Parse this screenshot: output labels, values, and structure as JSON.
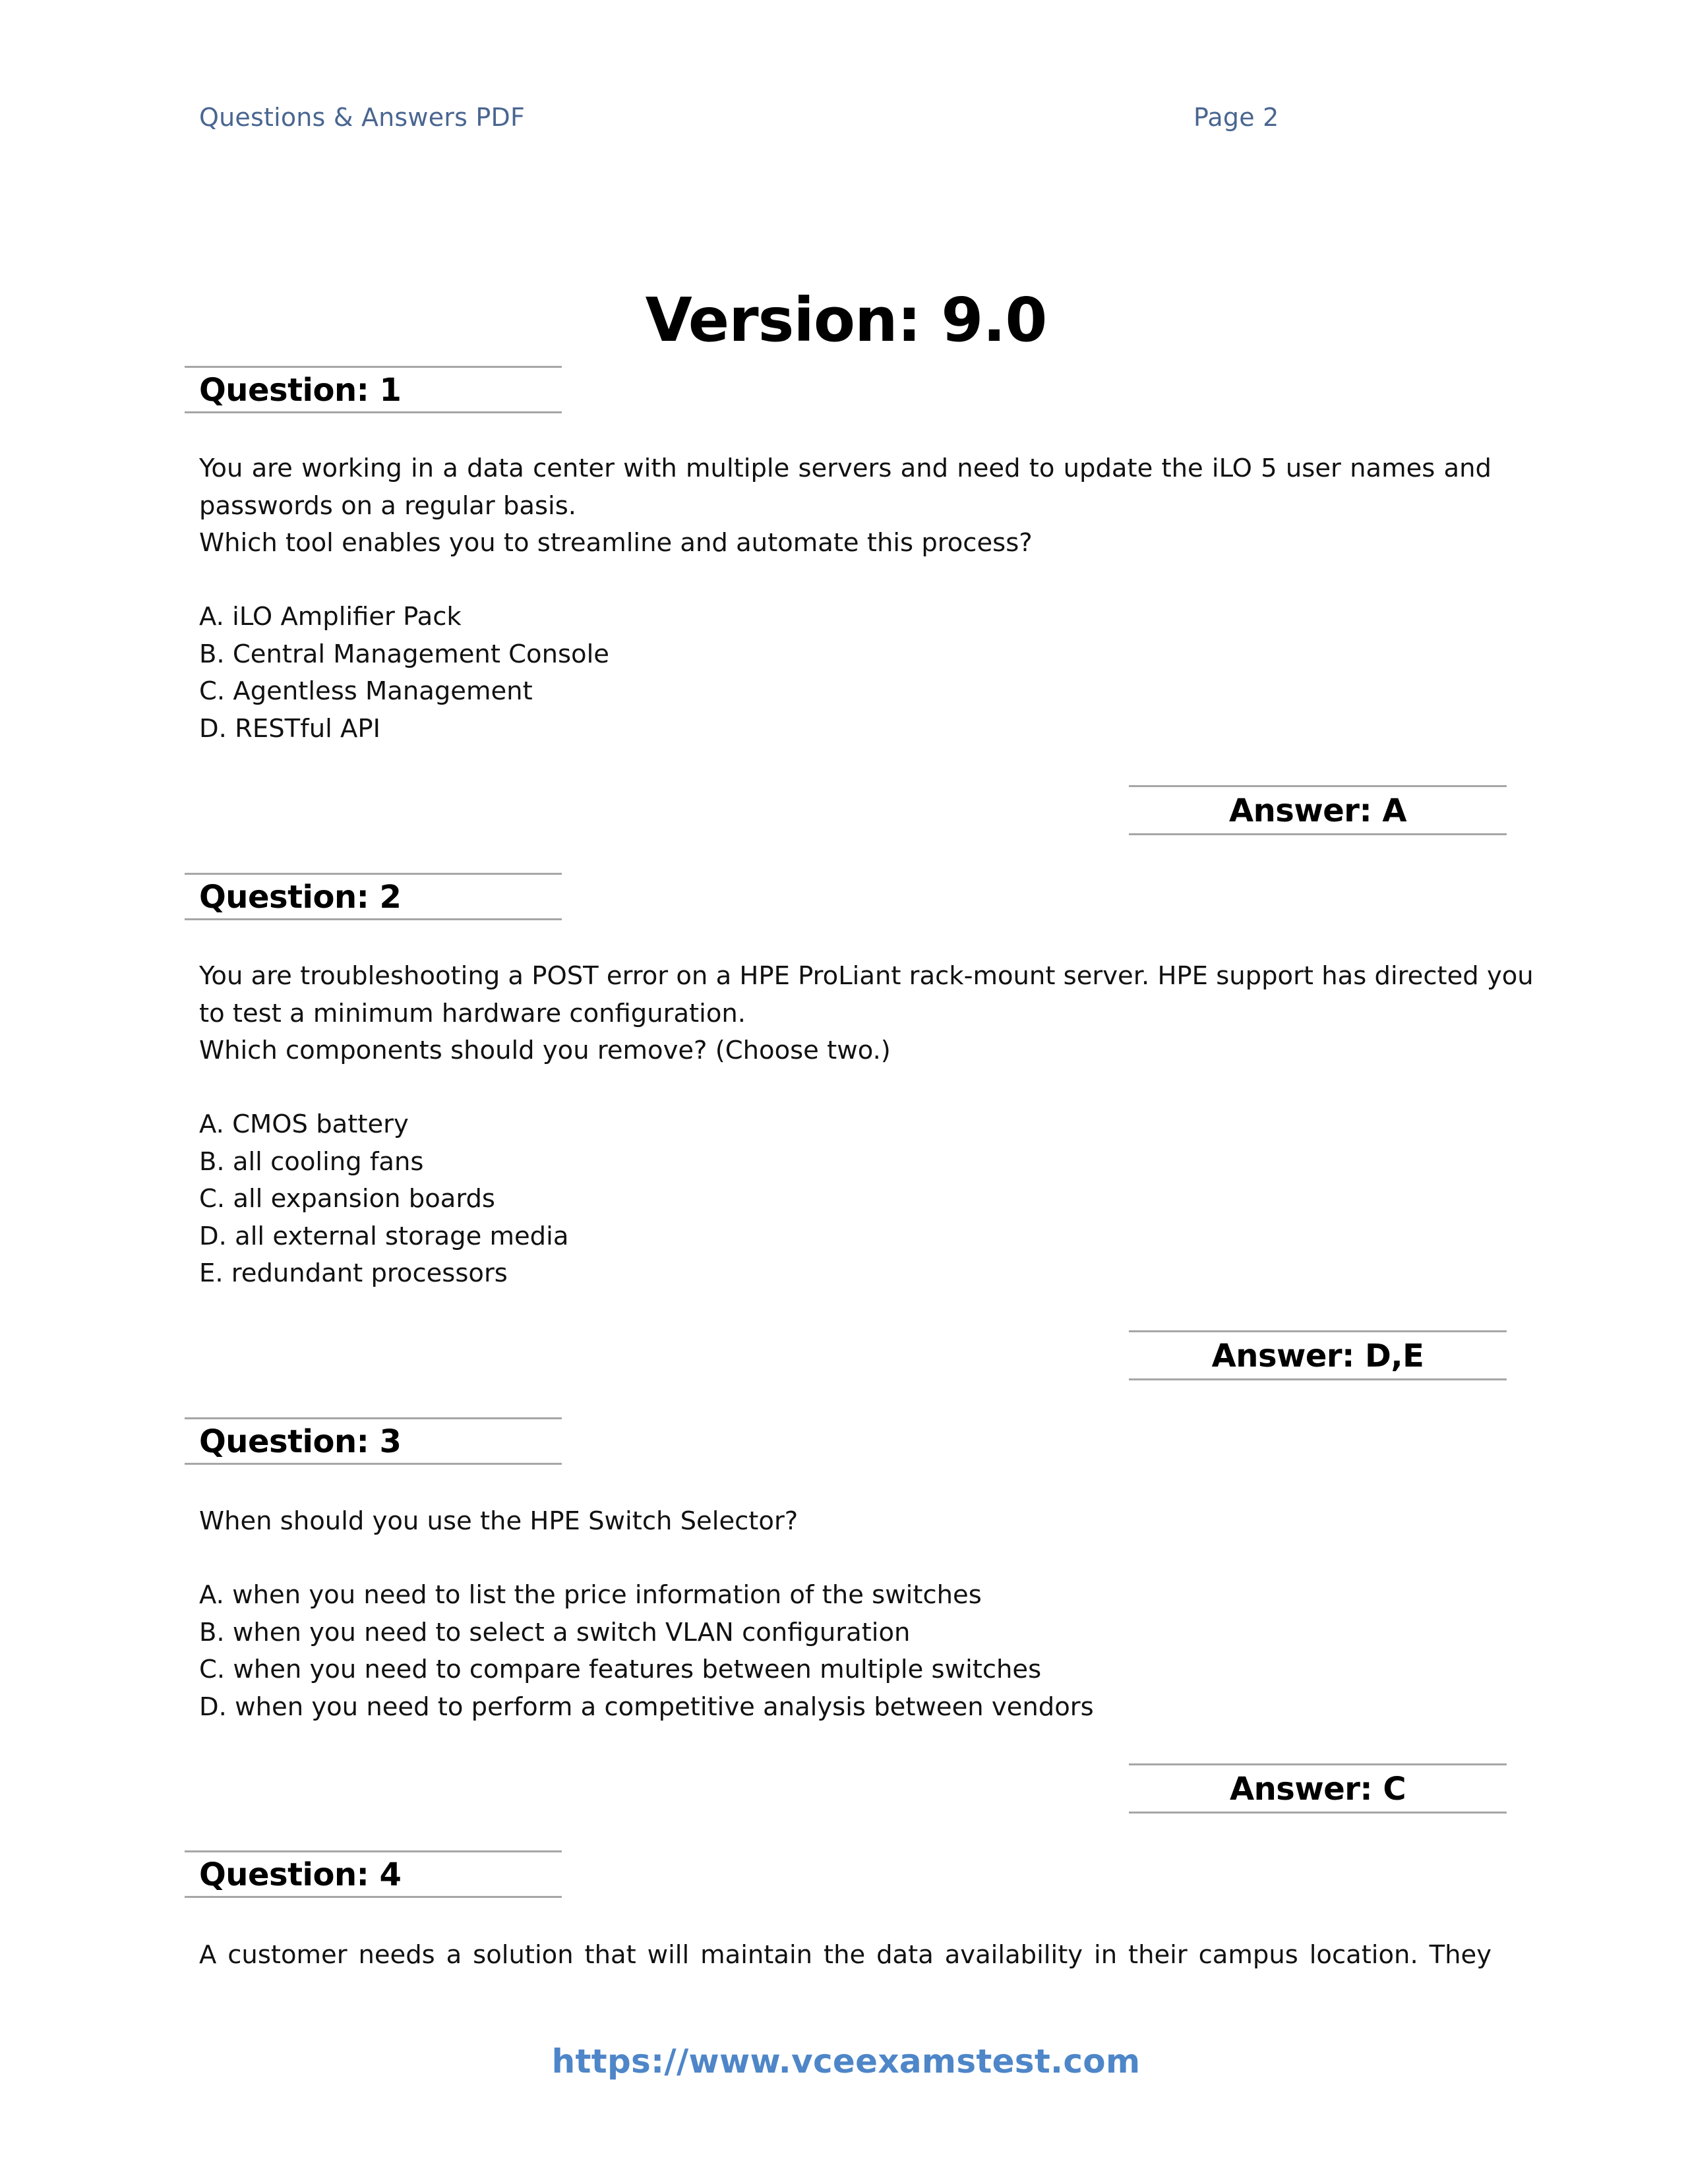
{
  "header": {
    "left_title": "Questions & Answers PDF",
    "page_label": "Page 2"
  },
  "version_title": "Version: 9.0",
  "questions": [
    {
      "label": "Question: 1",
      "stem_lines": [
        "You are working in a data center with multiple servers and need to update the iLO 5 user names and",
        "passwords on a regular basis.",
        "Which tool enables you to streamline and automate this process?"
      ],
      "options": [
        "A. iLO Amplifier Pack",
        "B. Central Management Console",
        "C. Agentless Management",
        "D. RESTful API"
      ],
      "answer": "Answer: A"
    },
    {
      "label": "Question: 2",
      "stem_lines": [
        "You are troubleshooting a POST error on a HPE ProLiant rack-mount server. HPE support has directed you",
        "to test a minimum hardware configuration.",
        "Which components should you remove? (Choose two.)"
      ],
      "options": [
        "A. CMOS battery",
        "B. all cooling fans",
        "C. all expansion boards",
        "D. all external storage media",
        "E. redundant processors"
      ],
      "answer": "Answer: D,E"
    },
    {
      "label": "Question: 3",
      "stem_lines": [
        "When should you use the HPE Switch Selector?"
      ],
      "options": [
        "A. when you need to list the price information of the switches",
        "B. when you need to select a switch VLAN configuration",
        "C. when you need to compare features between multiple switches",
        "D. when you need to perform a competitive analysis between vendors"
      ],
      "answer": "Answer: C"
    },
    {
      "label": "Question: 4",
      "stem_lines": [
        "A customer needs a solution that will maintain the data availability in their campus location. They"
      ]
    }
  ],
  "footer": {
    "url": "https://www.vceexamstest.com"
  }
}
